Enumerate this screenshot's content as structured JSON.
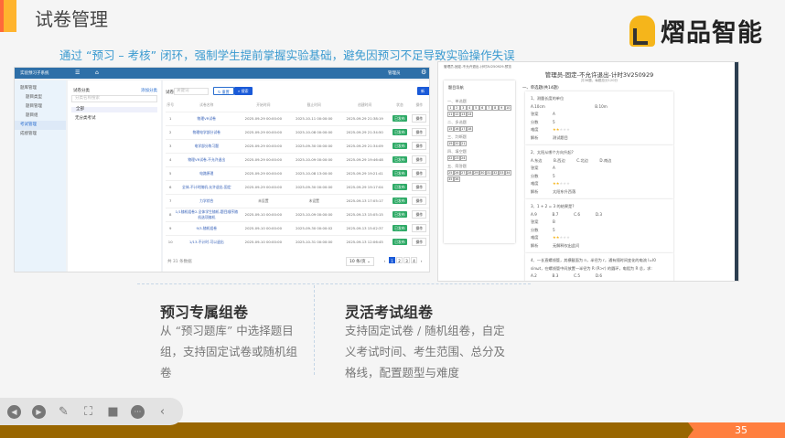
{
  "slide": {
    "title": "试卷管理",
    "brand": "熠品智能",
    "subtitle": "通过 “预习 – 考核” 闭环，强制学生提前掌握实验基础，避免因预习不足导致实验操作失误",
    "page_number": "35",
    "colors": {
      "accent": "#ffb42e",
      "subtitle": "#3a9ad0",
      "footer": "#996600",
      "page_box": "#ff7f3f"
    }
  },
  "app": {
    "system_name": "实验预习子系统",
    "user": "管理员",
    "sidebar": [
      {
        "label": "题库管理",
        "sub": false
      },
      {
        "label": "题目类型",
        "sub": true
      },
      {
        "label": "题目管理",
        "sub": true
      },
      {
        "label": "题目组",
        "sub": true
      },
      {
        "label": "考试管理",
        "sub": false,
        "active": true
      },
      {
        "label": "成绩管理",
        "sub": false
      }
    ],
    "tree": {
      "title": "试卷分类",
      "add": "添加分类",
      "search_placeholder": "分类名称搜索",
      "nodes": [
        "全部",
        "无分类考试"
      ]
    },
    "filter": {
      "label": "试卷",
      "placeholder": "关键词",
      "reset": "重置",
      "search": "搜索",
      "add": "新增"
    },
    "columns": [
      "序号",
      "试卷名称",
      "开始时间",
      "截止时间",
      "创建时间",
      "状态",
      "操作"
    ],
    "rows": [
      [
        "1",
        "物理VR试卷",
        "2025-09-29 00:00:00",
        "2025-10-11 00:00:00",
        "2025-09-29 21:38:19",
        "已发布",
        "操作"
      ],
      [
        "2",
        "物理电学部分试卷",
        "2025-09-29 00:00:00",
        "2025-10-08 00:00:00",
        "2025-09-29 21:34:50",
        "已发布",
        "操作"
      ],
      [
        "3",
        "电学部分练习题",
        "2025-09-29 00:00:00",
        "2025-09-30 00:00:00",
        "2025-09-29 21:34:09",
        "已发布",
        "操作"
      ],
      [
        "4",
        "物理VR试卷-不允许退出",
        "2025-09-29 00:00:00",
        "2025-10-09 00:00:00",
        "2025-09-29 19:46:48",
        "已发布",
        "操作"
      ],
      [
        "5",
        "电路原理",
        "2025-09-29 00:00:00",
        "2025-10-08 13:00:00",
        "2025-09-29 19:21:41",
        "已发布",
        "操作"
      ],
      [
        "6",
        "全体-不计时随机-允许退出-固定",
        "2025-09-29 00:00:00",
        "2025-09-30 00:00:00",
        "2025-09-29 19:17:04",
        "已发布",
        "操作"
      ],
      [
        "7",
        "力学综合",
        "未设置",
        "未设置",
        "2025-09-13 17:05:17",
        "已发布",
        "操作"
      ],
      [
        "8",
        "1/1随机组卷2-全体学生随机-题目顺序随机选项随机",
        "2025-09-10 00:00:00",
        "2025-10-09 00:00:00",
        "2025-09-13 15:05:15",
        "已发布",
        "操作"
      ],
      [
        "9",
        "9/3-随机组卷",
        "2025-09-10 00:00:00",
        "2025-09-30 00:00:02",
        "2025-09-13 15:02:37",
        "已发布",
        "操作"
      ],
      [
        "10",
        "1/13-不计时-可以退出",
        "2025-09-10 00:00:00",
        "2025-10-31 00:00:00",
        "2025-09-13 12:06:45",
        "已发布",
        "操作"
      ]
    ],
    "total": "共 31 条数据",
    "page_size": "10 条/页",
    "pages": [
      "1",
      "2",
      "3",
      "4"
    ]
  },
  "paper": {
    "breadcrumb": "管理员-固定-不允许退出-计时3V250929-预览",
    "title": "管理员-固定-不允许退出-计时3V250929",
    "meta": "共36题，每题总分120分",
    "section": "一、单选题(共14题)",
    "nav_title": "题目导航",
    "nav_groups": [
      {
        "label": "一、单选题",
        "nums": [
          "1",
          "2",
          "3",
          "4",
          "5",
          "6",
          "7",
          "8",
          "9",
          "10",
          "11",
          "12",
          "13",
          "14"
        ]
      },
      {
        "label": "二、多选题",
        "nums": [
          "15",
          "16",
          "17",
          "18"
        ]
      },
      {
        "label": "三、判断题",
        "nums": [
          "19",
          "20",
          "21"
        ]
      },
      {
        "label": "四、填空题",
        "nums": [
          "22",
          "23",
          "24"
        ]
      },
      {
        "label": "五、简答题",
        "nums": [
          "25",
          "26",
          "27",
          "28",
          "29",
          "30",
          "31",
          "32",
          "33",
          "34",
          "35",
          "36"
        ]
      }
    ],
    "questions": [
      {
        "stem": "1、测量长度的单位",
        "options": "A.10cm　　　　　　　　　　　　　B.10m",
        "answer": "A",
        "score": "5",
        "analysis": "测试题目"
      },
      {
        "stem": "2、太阳从哪个方向升起?",
        "options": "A.东边　　　B.西边　　　C.北边　　　D.南边",
        "answer": "A",
        "score": "5",
        "analysis": "太阳东升西落"
      },
      {
        "stem": "3、1 + 2 = 3 的结果是?",
        "options": "A.9　　　　B.7　　　　C.6　　　　D.3",
        "answer": "B",
        "score": "5",
        "analysis": "无解释仅出此问"
      },
      {
        "stem": "4、一长直螺线管，其横截面为 n，半径为 r，通有随时间变化的电流 I=I0 sinωt，在螺线管中间放置一半径为 R (R>r) 的圆环，电阻为 R 总，求:",
        "options": "A.2　　　　B.3　　　　C.5　　　　D.6"
      }
    ],
    "labels": {
      "answer": "答案",
      "score": "分数",
      "difficulty": "难度",
      "analysis": "解析"
    },
    "difficulty": 0.4
  },
  "features": [
    {
      "title": "预习专属组卷",
      "body": "从 “预习题库” 中选择题目组，支持固定试卷或随机组卷"
    },
    {
      "title": "灵活考试组卷",
      "body": "支持固定试卷 / 随机组卷，自定义考试时间、考生范围、总分及格线，配置题型与难度"
    }
  ],
  "toolbar": [
    "previous-icon",
    "next-icon",
    "pen-icon",
    "screenshot-icon",
    "camera-icon",
    "more-icon",
    "collapse-icon"
  ]
}
